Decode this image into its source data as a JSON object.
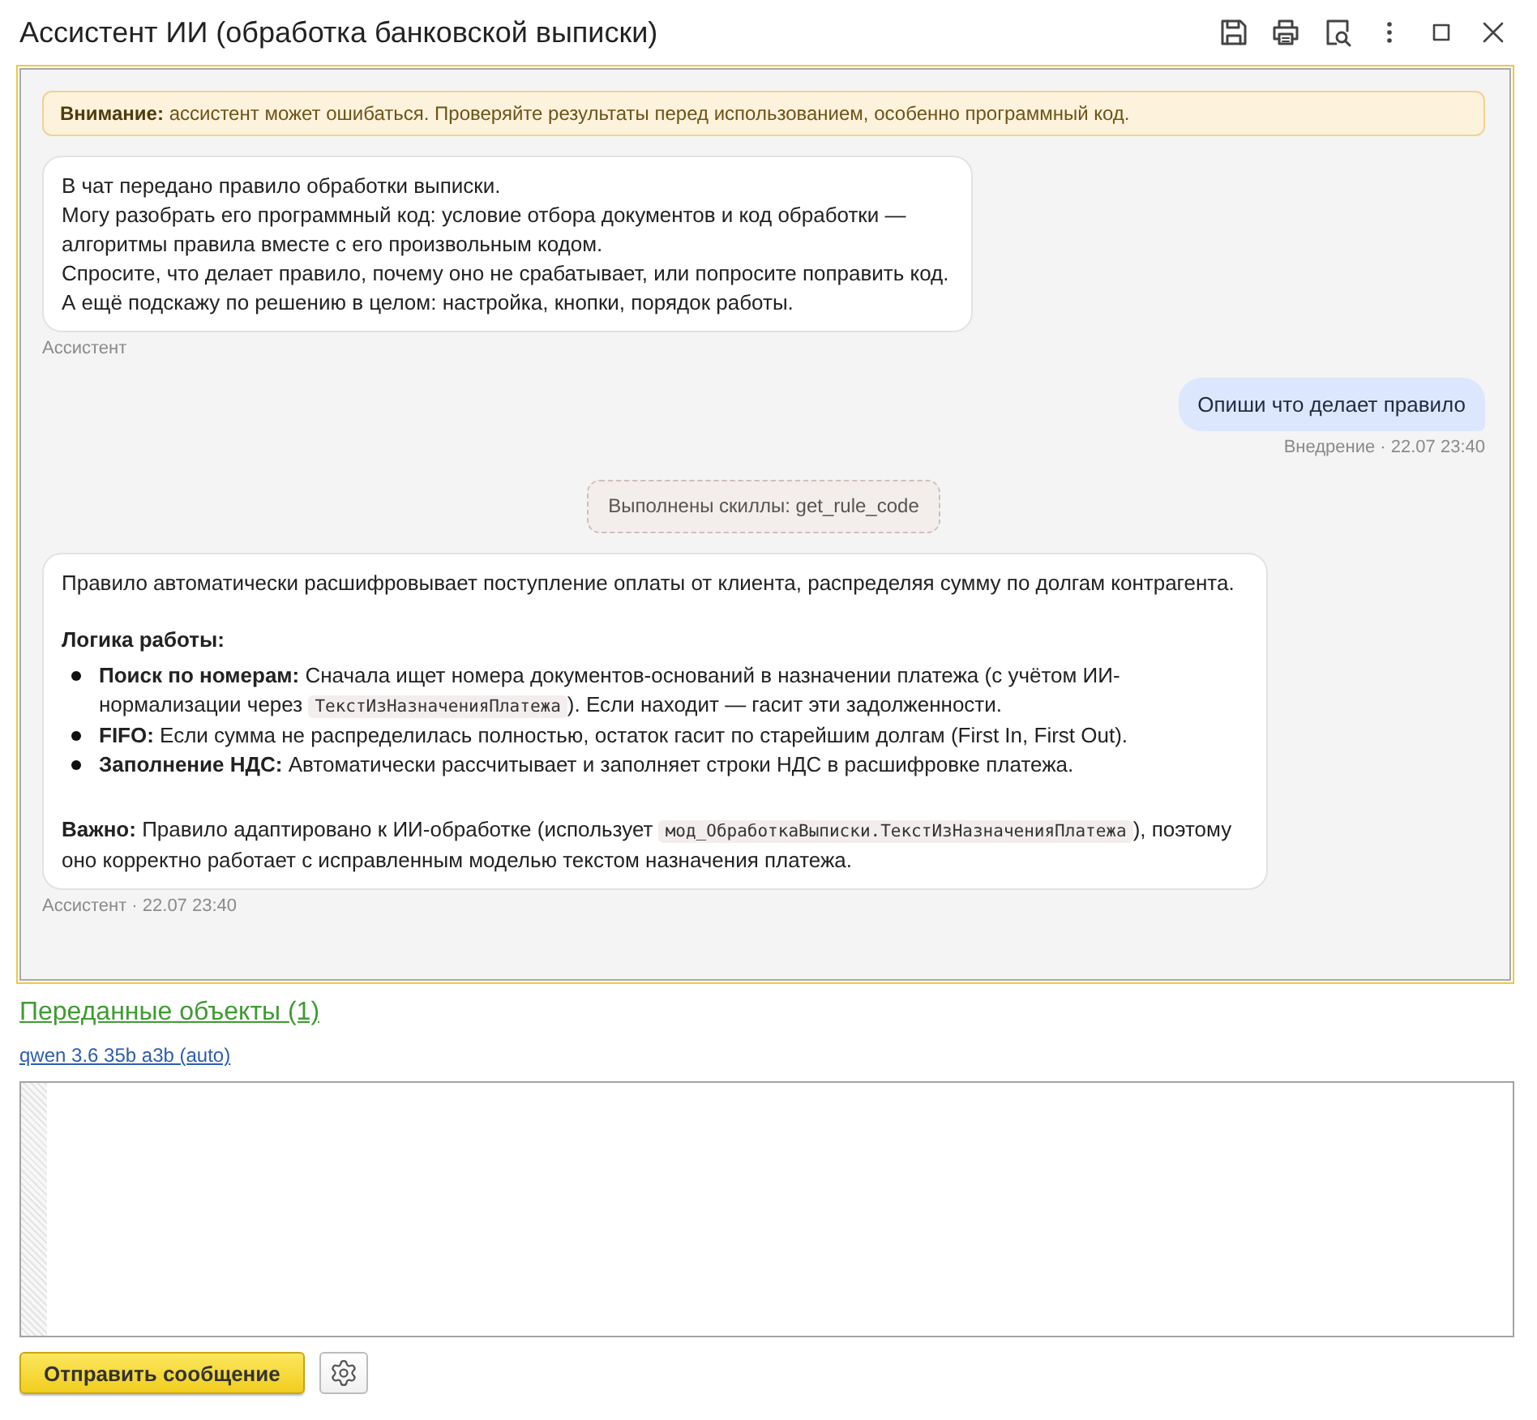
{
  "window": {
    "title": "Ассистент ИИ (обработка банковской выписки)"
  },
  "chat": {
    "warning": "**Внимание:** ассистент может ошибаться. Проверяйте результаты перед использованием, особенно программный код.",
    "messages": [
      {
        "kind": "assistant",
        "blocks": [
          {
            "kind": "line",
            "text": "В чат передано правило обработки выписки."
          },
          {
            "kind": "line",
            "text": "Могу разобрать его программный код: условие отбора документов и код обработки — алгоритмы правила вместе с его произвольным кодом."
          },
          {
            "kind": "line",
            "text": "Спросите, что делает правило, почему оно не срабатывает, или попросите поправить код."
          },
          {
            "kind": "line",
            "text": "А ещё подскажу по решению в целом: настройка, кнопки, порядок работы."
          }
        ],
        "meta": "Ассистент"
      },
      {
        "kind": "user",
        "text": "Опиши что делает правило",
        "meta": "Внедрение · 22.07 23:40"
      },
      {
        "kind": "skills",
        "text": "Выполнены скиллы: get_rule_code"
      },
      {
        "kind": "assistant",
        "blocks": [
          {
            "kind": "paragraph",
            "segments": [
              {
                "kind": "text",
                "text": "Правило автоматически расшифровывает поступление оплаты от клиента, распределяя сумму по долгам контрагента."
              }
            ]
          },
          {
            "kind": "heading",
            "text": "Логика работы:"
          },
          {
            "kind": "list",
            "items": [
              [
                {
                  "kind": "text",
                  "text": "**Поиск по номерам:** Сначала ищет номера документов-оснований в назначении платежа (с учётом ИИ-нормализации через "
                },
                {
                  "kind": "code",
                  "text": "ТекстИзНазначенияПлатежа"
                },
                {
                  "kind": "text",
                  "text": "). Если находит — гасит эти задолженности."
                }
              ],
              [
                {
                  "kind": "text",
                  "text": "**FIFO:** Если сумма не распределилась полностью, остаток гасит по старейшим долгам (First In, First Out)."
                }
              ],
              [
                {
                  "kind": "text",
                  "text": "**Заполнение НДС:** Автоматически рассчитывает и заполняет строки НДС в расшифровке платежа."
                }
              ]
            ]
          },
          {
            "kind": "paragraph",
            "segments": [
              {
                "kind": "text",
                "text": "**Важно:** Правило адаптировано к ИИ-обработке (использует "
              },
              {
                "kind": "code",
                "text": "мод_ОбработкаВыписки.ТекстИзНазначенияПлатежа"
              },
              {
                "kind": "text",
                "text": "), поэтому оно корректно работает с исправленным моделью текстом назначения платежа."
              }
            ]
          }
        ],
        "meta": "Ассистент · 22.07 23:40"
      }
    ]
  },
  "objects_link": "Переданные объекты (1)",
  "model_link": "qwen 3.6 35b a3b (auto)",
  "composer": {
    "send_button": "Отправить сообщение"
  }
}
